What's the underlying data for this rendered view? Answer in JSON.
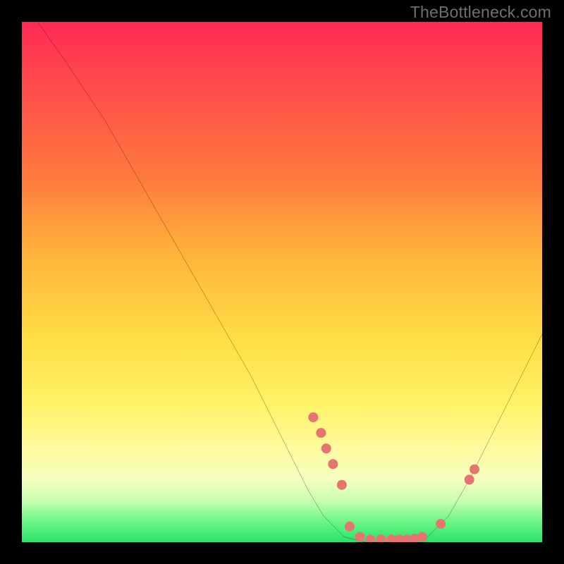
{
  "watermark": "TheBottleneck.com",
  "colors": {
    "background": "#000000",
    "curve": "#000000",
    "marker": "#e8746f",
    "gradient_top": "#ff2a55",
    "gradient_bottom": "#27e36c"
  },
  "chart_data": {
    "type": "line",
    "title": "",
    "xlabel": "",
    "ylabel": "",
    "xlim": [
      0,
      100
    ],
    "ylim": [
      0,
      100
    ],
    "grid": false,
    "legend": false,
    "series": [
      {
        "name": "curve",
        "x": [
          3,
          8,
          12,
          16,
          20,
          24,
          28,
          32,
          36,
          40,
          44,
          48,
          52,
          55,
          58,
          62,
          66,
          70,
          74,
          78,
          82,
          86,
          90,
          94,
          98,
          100
        ],
        "y": [
          100,
          93,
          87,
          81,
          74,
          67,
          60,
          53,
          46,
          39,
          32,
          24,
          16,
          10,
          5,
          1,
          0,
          0,
          0,
          1,
          5,
          12,
          20,
          28,
          36,
          40
        ]
      }
    ],
    "markers": {
      "name": "highlighted-points",
      "x": [
        56,
        57.5,
        58.5,
        59.8,
        61.5,
        63,
        65,
        67,
        69,
        71,
        72.5,
        74,
        75.5,
        77,
        80.5,
        86,
        87
      ],
      "y": [
        24,
        21,
        18,
        15,
        11,
        3,
        1,
        0.5,
        0.5,
        0.5,
        0.5,
        0.5,
        0.7,
        1,
        3.5,
        12,
        14
      ]
    }
  }
}
